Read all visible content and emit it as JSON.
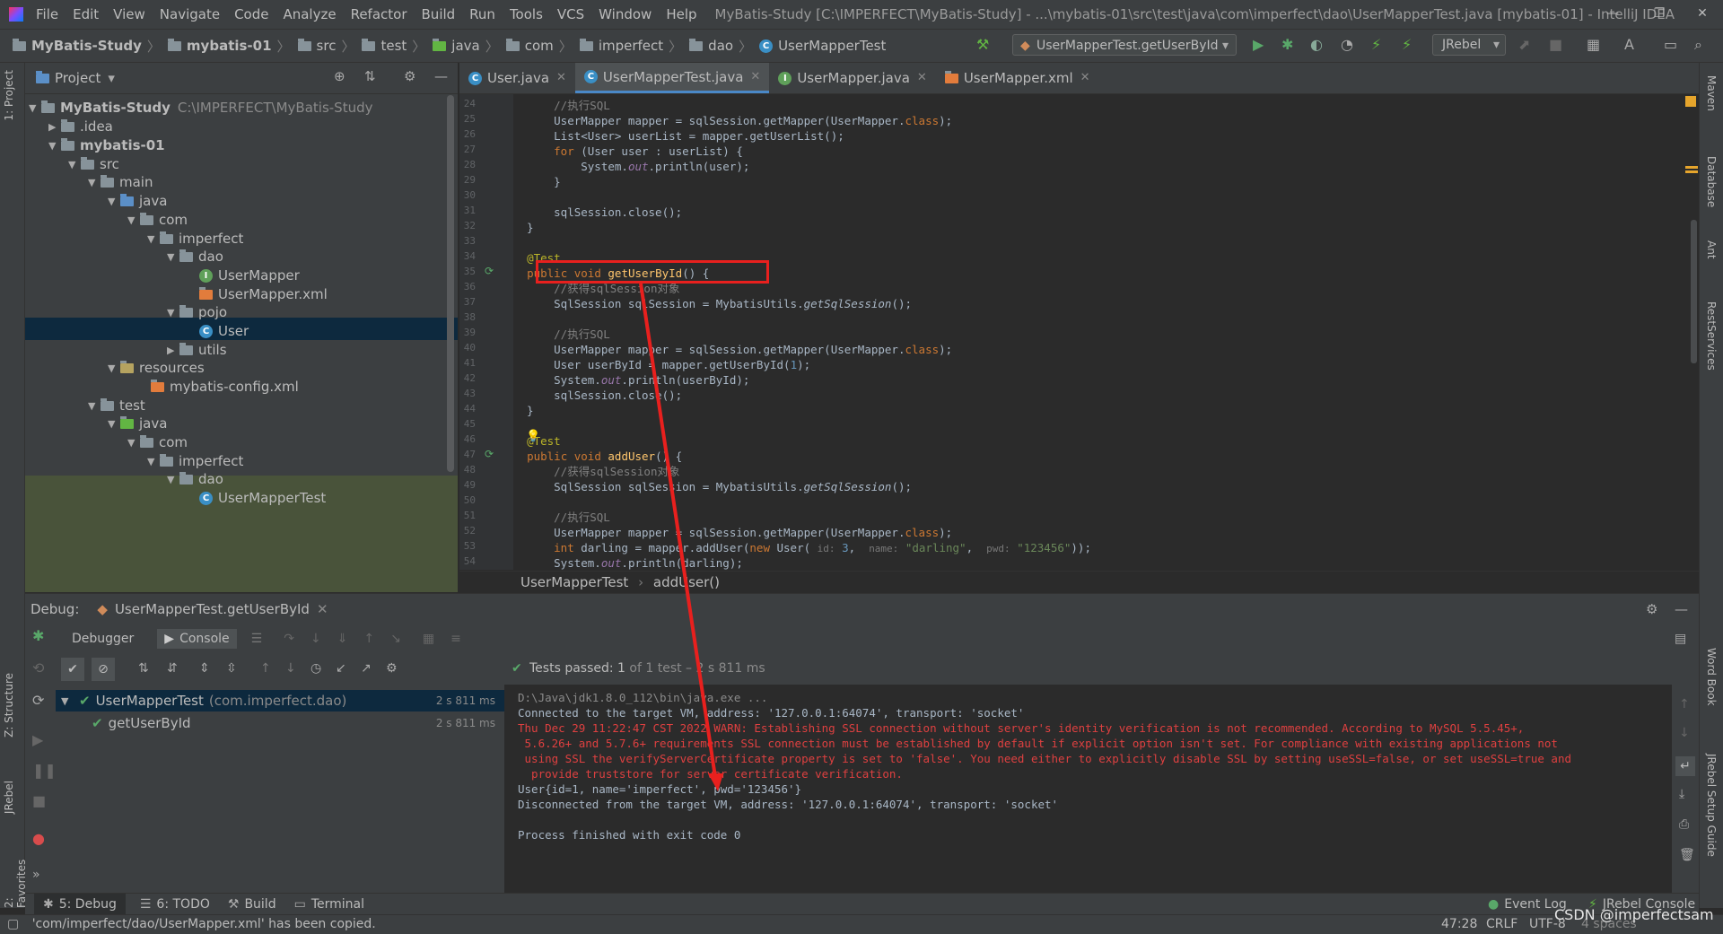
{
  "menu": {
    "items": [
      "File",
      "Edit",
      "View",
      "Navigate",
      "Code",
      "Analyze",
      "Refactor",
      "Build",
      "Run",
      "Tools",
      "VCS",
      "Window",
      "Help"
    ],
    "window_title": "MyBatis-Study [C:\\IMPERFECT\\MyBatis-Study] - ...\\mybatis-01\\src\\test\\java\\com\\imperfect\\dao\\UserMapperTest.java [mybatis-01] - IntelliJ IDEA"
  },
  "breadcrumbs": [
    "MyBatis-Study",
    "mybatis-01",
    "src",
    "test",
    "java",
    "com",
    "imperfect",
    "dao",
    "UserMapperTest"
  ],
  "toolbar": {
    "run_config": "UserMapperTest.getUserById",
    "jrebel": "JRebel"
  },
  "project": {
    "title": "Project",
    "tree": [
      {
        "label": "MyBatis-Study",
        "path": "C:\\IMPERFECT\\MyBatis-Study"
      },
      {
        "label": ".idea"
      },
      {
        "label": "mybatis-01"
      },
      {
        "label": "src"
      },
      {
        "label": "main"
      },
      {
        "label": "java"
      },
      {
        "label": "com"
      },
      {
        "label": "imperfect"
      },
      {
        "label": "dao"
      },
      {
        "label": "UserMapper"
      },
      {
        "label": "UserMapper.xml"
      },
      {
        "label": "pojo"
      },
      {
        "label": "User"
      },
      {
        "label": "utils"
      },
      {
        "label": "resources"
      },
      {
        "label": "mybatis-config.xml"
      },
      {
        "label": "test"
      },
      {
        "label": "java"
      },
      {
        "label": "com"
      },
      {
        "label": "imperfect"
      },
      {
        "label": "dao"
      },
      {
        "label": "UserMapperTest"
      }
    ]
  },
  "editor": {
    "tabs": [
      {
        "label": "User.java"
      },
      {
        "label": "UserMapperTest.java"
      },
      {
        "label": "UserMapper.java"
      },
      {
        "label": "UserMapper.xml"
      }
    ],
    "line_numbers": [
      "24",
      "25",
      "26",
      "27",
      "28",
      "29",
      "30",
      "31",
      "32",
      "33",
      "34",
      "35",
      "36",
      "37",
      "38",
      "39",
      "40",
      "41",
      "42",
      "43",
      "44",
      "45",
      "46",
      "47",
      "48",
      "49",
      "50",
      "51",
      "52",
      "53",
      "54"
    ],
    "breadcrumb": [
      "UserMapperTest",
      "addUser()"
    ]
  },
  "debug": {
    "label": "Debug:",
    "config_tab": "UserMapperTest.getUserById",
    "tabs": [
      "Debugger",
      "Console"
    ],
    "tests_passed": "Tests passed:",
    "tests_count": "1",
    "tests_summary": "of 1 test – 2 s 811 ms",
    "tree": [
      {
        "label": "UserMapperTest",
        "pkg": "(com.imperfect.dao)",
        "time": "2 s 811 ms"
      },
      {
        "label": "getUserById",
        "time": "2 s 811 ms"
      }
    ],
    "console": [
      "D:\\Java\\jdk1.8.0_112\\bin\\java.exe ...",
      "Connected to the target VM, address: '127.0.0.1:64074', transport: 'socket'",
      "Thu Dec 29 11:22:47 CST 2022 WARN: Establishing SSL connection without server's identity verification is not recommended. According to MySQL 5.5.45+,",
      " 5.6.26+ and 5.7.6+ requirements SSL connection must be established by default if explicit option isn't set. For compliance with existing applications not",
      " using SSL the verifyServerCertificate property is set to 'false'. You need either to explicitly disable SSL by setting useSSL=false, or set useSSL=true and",
      "  provide truststore for server certificate verification.",
      "User{id=1, name='imperfect', pwd='123456'}",
      "Disconnected from the target VM, address: '127.0.0.1:64074', transport: 'socket'",
      "",
      "Process finished with exit code 0"
    ]
  },
  "tool_tabs": [
    "5: Debug",
    "6: TODO",
    "Build",
    "Terminal",
    "Event Log",
    "JRebel Console"
  ],
  "status": {
    "message": "'com/imperfect/dao/UserMapper.xml' has been copied.",
    "position": "47:28",
    "line_sep": "CRLF",
    "encoding": "UTF-8",
    "indent": "4 spaces",
    "watermark": "CSDN @imperfectsam"
  },
  "side_tabs": {
    "left": [
      "1: Project",
      "Z: Structure",
      "JRebel",
      "2: Favorites"
    ],
    "right": [
      "Maven",
      "Database",
      "Ant",
      "RestServices",
      "Word Book",
      "JRebel Setup Guide"
    ]
  },
  "colors": {
    "annotation_red": "#e8201e",
    "accent": "#4a88c7"
  }
}
